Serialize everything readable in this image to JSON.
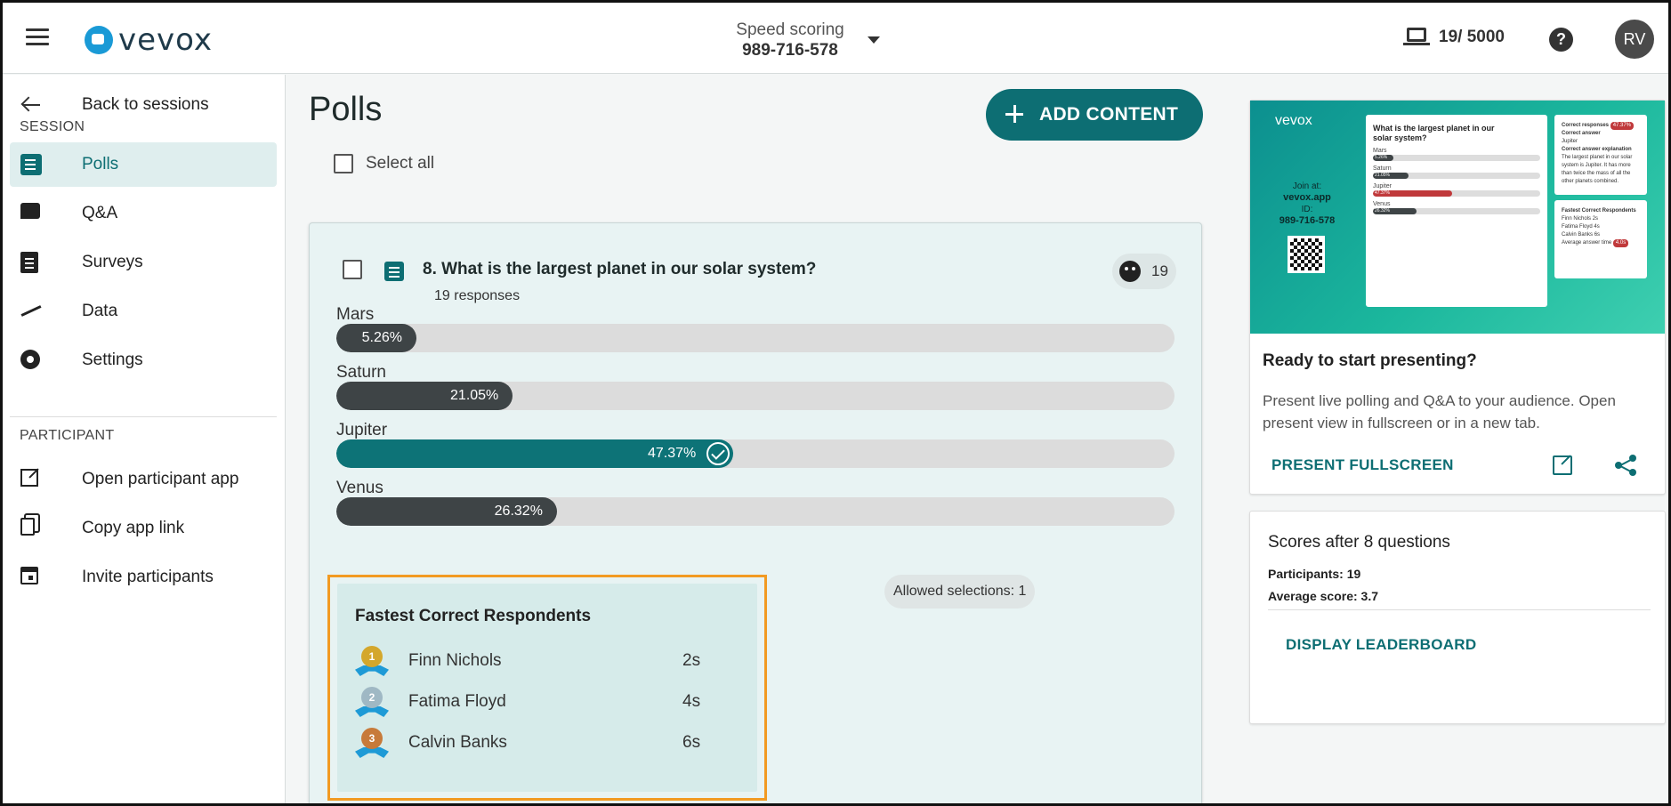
{
  "header": {
    "logo_text": "vevox",
    "session_name": "Speed scoring",
    "session_id": "989-716-578",
    "device_count": "19/ 5000",
    "help_symbol": "?",
    "avatar_initials": "RV"
  },
  "sidebar": {
    "back_label": "Back to sessions",
    "session_section": "SESSION",
    "items": [
      {
        "label": "Polls",
        "icon": "polls-icon",
        "active": true
      },
      {
        "label": "Q&A",
        "icon": "qa-icon"
      },
      {
        "label": "Surveys",
        "icon": "surveys-icon"
      },
      {
        "label": "Data",
        "icon": "data-icon"
      },
      {
        "label": "Settings",
        "icon": "settings-icon"
      }
    ],
    "participant_section": "PARTICIPANT",
    "participant_items": [
      {
        "label": "Open participant app",
        "icon": "open-external-icon"
      },
      {
        "label": "Copy app link",
        "icon": "copy-icon"
      },
      {
        "label": "Invite participants",
        "icon": "calendar-icon"
      }
    ]
  },
  "main": {
    "title": "Polls",
    "add_content_label": "ADD CONTENT",
    "select_all_label": "Select all",
    "poll": {
      "question": "8. What is the largest planet in our solar system?",
      "responses_text": "19 responses",
      "response_count": "19",
      "options": [
        {
          "label": "Mars",
          "percent_text": "5.26%",
          "percent": 5.26,
          "correct": false
        },
        {
          "label": "Saturn",
          "percent_text": "21.05%",
          "percent": 21.05,
          "correct": false
        },
        {
          "label": "Jupiter",
          "percent_text": "47.37%",
          "percent": 47.37,
          "correct": true
        },
        {
          "label": "Venus",
          "percent_text": "26.32%",
          "percent": 26.32,
          "correct": false
        }
      ],
      "fastest": {
        "title": "Fastest Correct Respondents",
        "respondents": [
          {
            "rank": "1",
            "name": "Finn Nichols",
            "time": "2s",
            "medal_color": "#d4a72c"
          },
          {
            "rank": "2",
            "name": "Fatima Floyd",
            "time": "4s",
            "medal_color": "#9fb8c4"
          },
          {
            "rank": "3",
            "name": "Calvin Banks",
            "time": "6s",
            "medal_color": "#c77a3a"
          }
        ]
      },
      "allowed_selections": "Allowed selections: 1"
    }
  },
  "present": {
    "preview": {
      "logo_text": "vevox",
      "join_label": "Join at:",
      "join_url": "vevox.app",
      "id_label": "ID:",
      "id_value": "989-716-578",
      "question": "What is the largest planet in our solar system?",
      "options": [
        {
          "label": "Mars",
          "pct": "5.26%"
        },
        {
          "label": "Saturn",
          "pct": "21.05%"
        },
        {
          "label": "Jupiter",
          "pct": "47.37%"
        },
        {
          "label": "Venus",
          "pct": "26.32%"
        }
      ],
      "side_correct_responses": "Correct responses",
      "side_correct_pct": "47.37%",
      "side_correct_answer": "Correct answer",
      "side_answer_value": "Jupiter",
      "side_explanation": "Correct answer explanation",
      "side_explanation_text": "The largest planet in our solar system is Jupiter. It has more than twice the mass of all the other planets combined.",
      "side_fastest": "Fastest Correct Respondents",
      "side_names": [
        "Finn Nichols",
        "Fatima Floyd",
        "Calvin Banks"
      ],
      "side_times": [
        "2s",
        "4s",
        "6s"
      ],
      "side_avg": "Average answer time",
      "side_avg_value": "4.0s"
    },
    "title": "Ready to start presenting?",
    "text": "Present live polling and Q&A to your audience. Open present view in fullscreen or in a new tab.",
    "fullscreen_label": "PRESENT FULLSCREEN"
  },
  "scores": {
    "title": "Scores after 8 questions",
    "participants_label": "Participants:",
    "participants_value": "19",
    "average_label": "Average score:",
    "average_value": "3.7",
    "leaderboard_label": "DISPLAY LEADERBOARD"
  },
  "colors": {
    "brand": "#0d6e73",
    "bar_dark": "#3e4446",
    "highlight": "#f29a22"
  }
}
